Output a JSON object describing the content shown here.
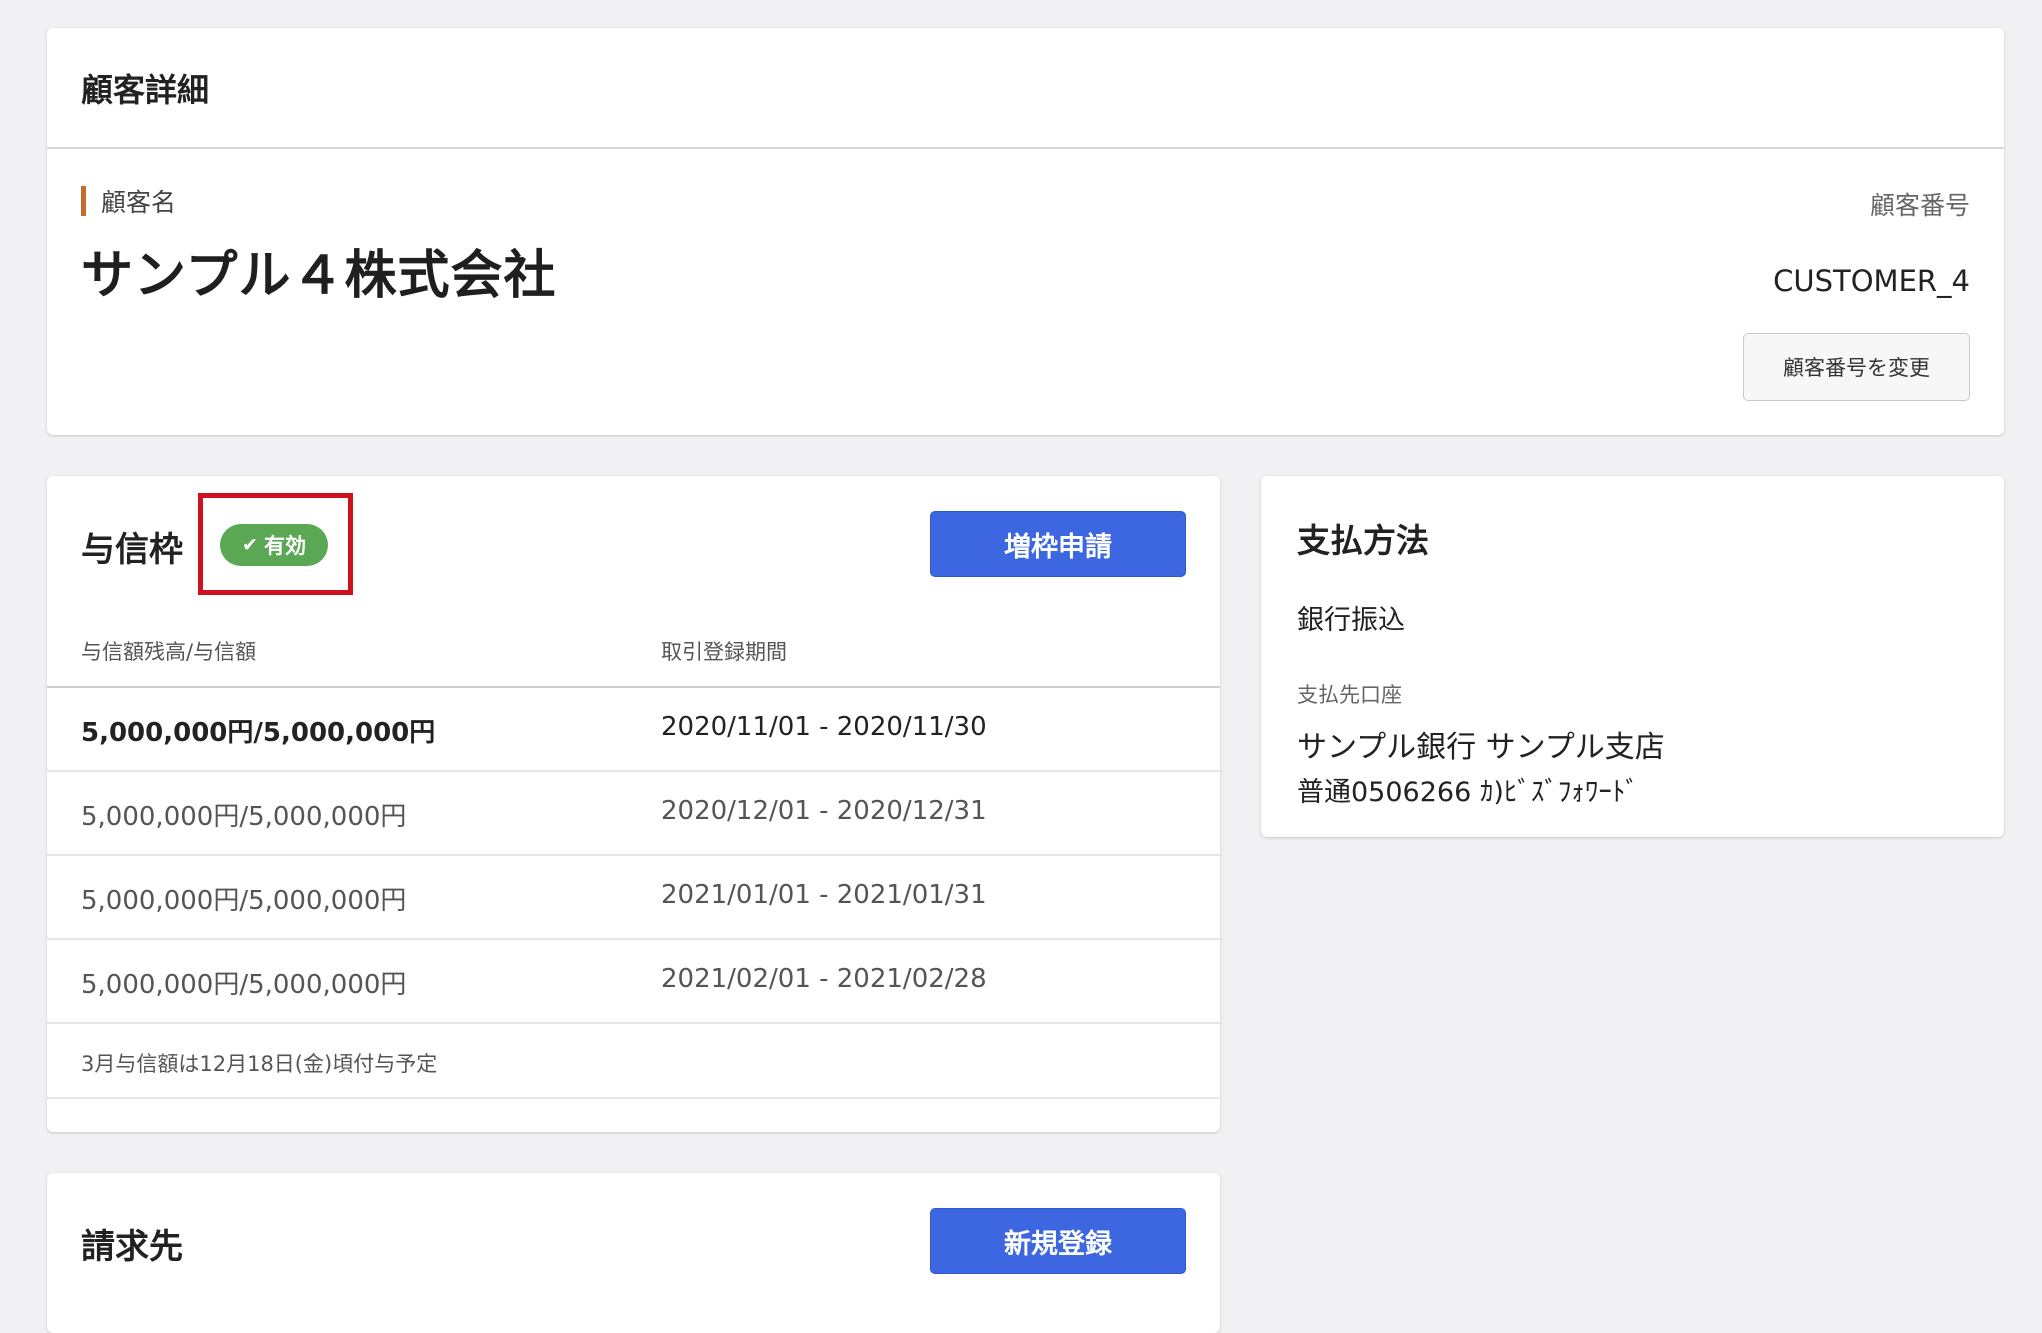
{
  "customer_card": {
    "title": "顧客詳細",
    "name_label": "顧客名",
    "name": "サンプル４株式会社",
    "number_label": "顧客番号",
    "number": "CUSTOMER_4",
    "change_number_button": "顧客番号を変更"
  },
  "credit_card": {
    "title": "与信枠",
    "status_badge": "有効",
    "increase_button": "増枠申請",
    "columns": [
      "与信額残高/与信額",
      "取引登録期間"
    ],
    "rows": [
      {
        "amount": "5,000,000円/5,000,000円",
        "period": "2020/11/01 - 2020/11/30"
      },
      {
        "amount": "5,000,000円/5,000,000円",
        "period": "2020/12/01 - 2020/12/31"
      },
      {
        "amount": "5,000,000円/5,000,000円",
        "period": "2021/01/01 - 2021/01/31"
      },
      {
        "amount": "5,000,000円/5,000,000円",
        "period": "2021/02/01 - 2021/02/28"
      }
    ],
    "note": "3月与信額は12月18日(金)頃付与予定"
  },
  "payment_card": {
    "title": "支払方法",
    "method": "銀行振込",
    "account_label": "支払先口座",
    "account_line1": "サンプル銀行 サンプル支店",
    "account_line2": "普通0506266 ｶ)ﾋﾞｽﾞﾌｫﾜｰﾄﾞ"
  },
  "billing_card": {
    "title": "請求先",
    "new_button": "新規登録"
  },
  "colors": {
    "primary": "#3d67e0",
    "badge_green": "#5aa854",
    "label_bar": "#c8692f",
    "highlight_red": "#d0101c"
  }
}
